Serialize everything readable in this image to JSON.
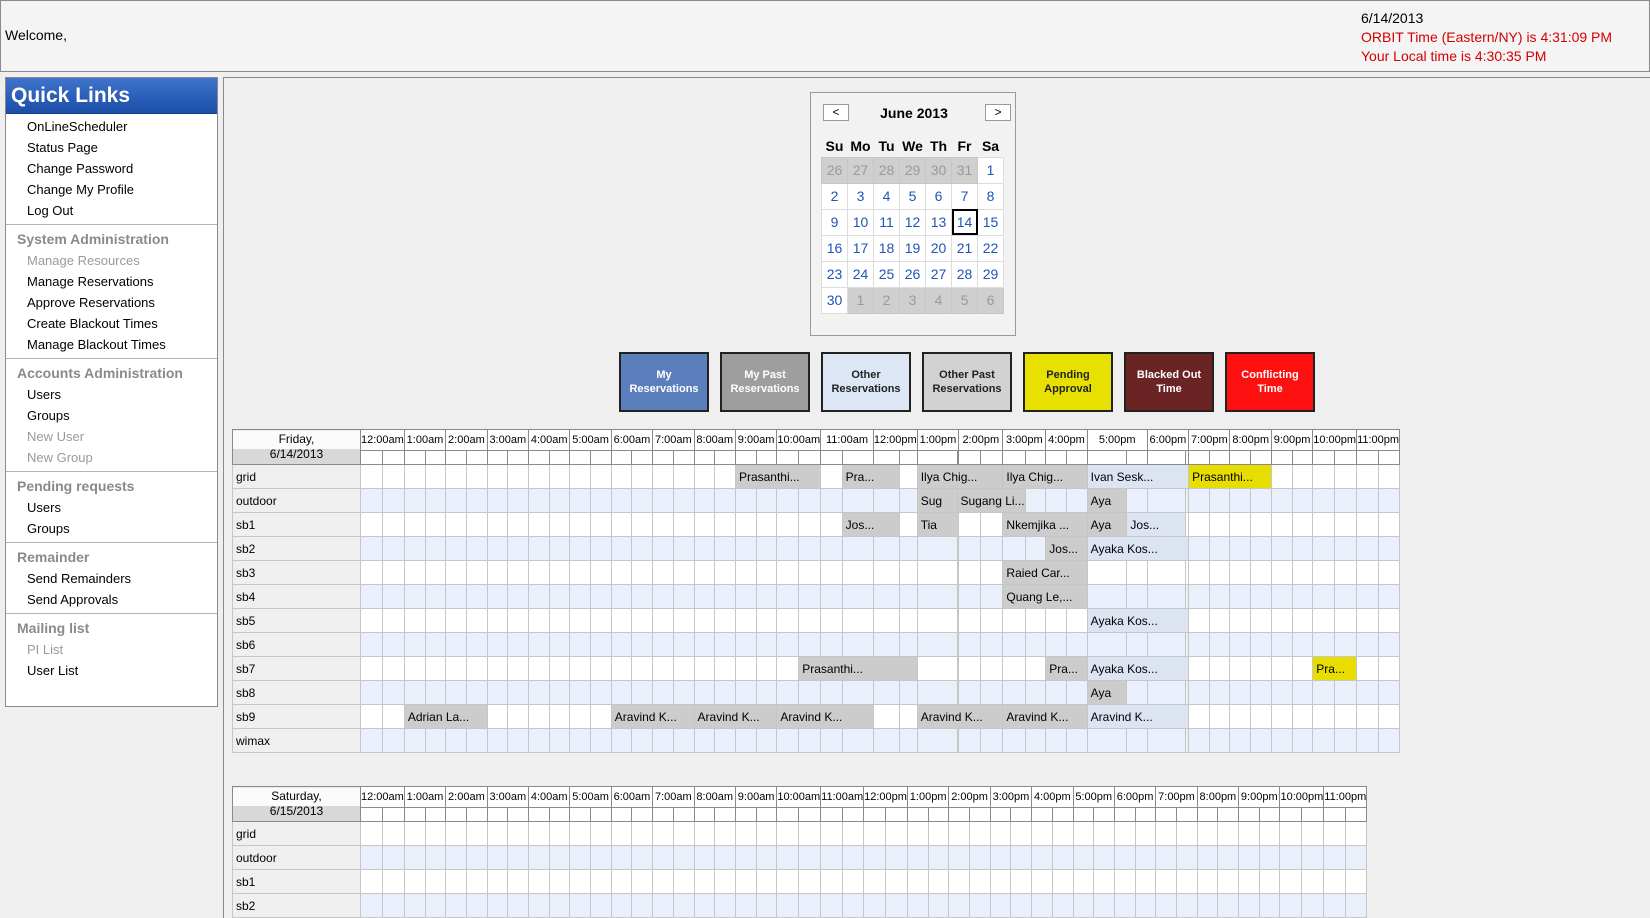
{
  "header": {
    "welcome": "Welcome,",
    "date": "6/14/2013",
    "orbit_time": "ORBIT Time (Eastern/NY) is 4:31:09 PM",
    "local_time": "Your Local time is 4:30:35 PM"
  },
  "quicklinks": {
    "title": "Quick Links",
    "groups": [
      {
        "heading": "",
        "links": [
          {
            "label": "OnLineScheduler",
            "enabled": true
          },
          {
            "label": "Status Page",
            "enabled": true
          },
          {
            "label": "Change Password",
            "enabled": true
          },
          {
            "label": "Change My Profile",
            "enabled": true
          },
          {
            "label": "Log Out",
            "enabled": true
          }
        ]
      },
      {
        "heading": "System Administration",
        "links": [
          {
            "label": "Manage Resources",
            "enabled": false
          },
          {
            "label": "Manage Reservations",
            "enabled": true
          },
          {
            "label": "Approve Reservations",
            "enabled": true
          },
          {
            "label": "Create Blackout Times",
            "enabled": true
          },
          {
            "label": "Manage Blackout Times",
            "enabled": true
          }
        ]
      },
      {
        "heading": "Accounts Administration",
        "links": [
          {
            "label": "Users",
            "enabled": true
          },
          {
            "label": "Groups",
            "enabled": true
          },
          {
            "label": "New User",
            "enabled": false
          },
          {
            "label": "New Group",
            "enabled": false
          }
        ]
      },
      {
        "heading": "Pending requests",
        "links": [
          {
            "label": "Users",
            "enabled": true
          },
          {
            "label": "Groups",
            "enabled": true
          }
        ]
      },
      {
        "heading": "Remainder",
        "links": [
          {
            "label": "Send Remainders",
            "enabled": true
          },
          {
            "label": "Send Approvals",
            "enabled": true
          }
        ]
      },
      {
        "heading": "Mailing list",
        "links": [
          {
            "label": "PI List",
            "enabled": false
          },
          {
            "label": "User List",
            "enabled": true
          }
        ]
      }
    ]
  },
  "calendar": {
    "title": "June 2013",
    "prev": "<",
    "next": ">",
    "weekdays": [
      "Su",
      "Mo",
      "Tu",
      "We",
      "Th",
      "Fr",
      "Sa"
    ],
    "weeks": [
      [
        {
          "d": "26",
          "o": true
        },
        {
          "d": "27",
          "o": true
        },
        {
          "d": "28",
          "o": true
        },
        {
          "d": "29",
          "o": true
        },
        {
          "d": "30",
          "o": true
        },
        {
          "d": "31",
          "o": true
        },
        {
          "d": "1"
        }
      ],
      [
        {
          "d": "2"
        },
        {
          "d": "3"
        },
        {
          "d": "4"
        },
        {
          "d": "5"
        },
        {
          "d": "6"
        },
        {
          "d": "7"
        },
        {
          "d": "8"
        }
      ],
      [
        {
          "d": "9"
        },
        {
          "d": "10"
        },
        {
          "d": "11"
        },
        {
          "d": "12"
        },
        {
          "d": "13"
        },
        {
          "d": "14",
          "t": true
        },
        {
          "d": "15"
        }
      ],
      [
        {
          "d": "16"
        },
        {
          "d": "17"
        },
        {
          "d": "18"
        },
        {
          "d": "19"
        },
        {
          "d": "20"
        },
        {
          "d": "21"
        },
        {
          "d": "22"
        }
      ],
      [
        {
          "d": "23"
        },
        {
          "d": "24"
        },
        {
          "d": "25"
        },
        {
          "d": "26"
        },
        {
          "d": "27"
        },
        {
          "d": "28"
        },
        {
          "d": "29"
        }
      ],
      [
        {
          "d": "30"
        },
        {
          "d": "1",
          "o": true
        },
        {
          "d": "2",
          "o": true
        },
        {
          "d": "3",
          "o": true
        },
        {
          "d": "4",
          "o": true
        },
        {
          "d": "5",
          "o": true
        },
        {
          "d": "6",
          "o": true
        }
      ]
    ]
  },
  "legend": [
    {
      "label": "My Reservations",
      "bg": "#5b7fbd",
      "fg": "#ffffff"
    },
    {
      "label": "My Past Reservations",
      "bg": "#9e9e9e",
      "fg": "#ffffff"
    },
    {
      "label": "Other Reservations",
      "bg": "#dce6f5",
      "fg": "#222222"
    },
    {
      "label": "Other Past Reservations",
      "bg": "#d2d2d2",
      "fg": "#222222"
    },
    {
      "label": "Pending Approval",
      "bg": "#e8e000",
      "fg": "#222222"
    },
    {
      "label": "Blacked Out Time",
      "bg": "#6b2424",
      "fg": "#ffffff"
    },
    {
      "label": "Conflicting Time",
      "bg": "#ff1010",
      "fg": "#ffffff"
    }
  ],
  "hours": [
    "12:00am",
    "1:00am",
    "2:00am",
    "3:00am",
    "4:00am",
    "5:00am",
    "6:00am",
    "7:00am",
    "8:00am",
    "9:00am",
    "10:00am",
    "11:00am",
    "12:00pm",
    "1:00pm",
    "2:00pm",
    "3:00pm",
    "4:00pm",
    "5:00pm",
    "6:00pm",
    "7:00pm",
    "8:00pm",
    "9:00pm",
    "10:00pm",
    "11:00pm"
  ],
  "days": [
    {
      "day": "Friday,",
      "date": "6/14/2013",
      "resources": [
        {
          "name": "grid",
          "blocks": [
            {
              "start": 18,
              "span": 4,
              "label": "Prasanthi...",
              "kind": "other"
            },
            {
              "start": 23,
              "span": 2,
              "label": "Pra...",
              "kind": "other"
            },
            {
              "start": 26,
              "span": 4,
              "label": "Ilya Chig...",
              "kind": "other"
            },
            {
              "start": 30,
              "span": 4,
              "label": "Ilya Chig...",
              "kind": "other"
            },
            {
              "start": 34,
              "span": 4,
              "label": "Ivan Sesk...",
              "kind": "mine"
            },
            {
              "start": 38,
              "span": 4,
              "label": "Prasanthi...",
              "kind": "pending"
            }
          ]
        },
        {
          "name": "outdoor",
          "blocks": [
            {
              "start": 26,
              "span": 1,
              "label": "Sug",
              "kind": "other"
            },
            {
              "start": 27,
              "span": 4,
              "label": "Sugang Li...",
              "kind": "other"
            },
            {
              "start": 34,
              "span": 1,
              "label": "Aya",
              "kind": "other"
            }
          ]
        },
        {
          "name": "sb1",
          "blocks": [
            {
              "start": 23,
              "span": 2,
              "label": "Jos...",
              "kind": "other"
            },
            {
              "start": 26,
              "span": 2,
              "label": "Tia",
              "kind": "other"
            },
            {
              "start": 30,
              "span": 4,
              "label": "Nkemjika ...",
              "kind": "other"
            },
            {
              "start": 34,
              "span": 1,
              "label": "Aya",
              "kind": "other"
            },
            {
              "start": 35,
              "span": 2,
              "label": "Jos...",
              "kind": "mine"
            }
          ]
        },
        {
          "name": "sb2",
          "blocks": [
            {
              "start": 32,
              "span": 2,
              "label": "Jos...",
              "kind": "other"
            },
            {
              "start": 34,
              "span": 4,
              "label": "Ayaka Kos...",
              "kind": "mine"
            }
          ]
        },
        {
          "name": "sb3",
          "blocks": [
            {
              "start": 30,
              "span": 4,
              "label": "Raied Car...",
              "kind": "other"
            }
          ]
        },
        {
          "name": "sb4",
          "blocks": [
            {
              "start": 30,
              "span": 4,
              "label": "Quang Le,...",
              "kind": "other"
            }
          ]
        },
        {
          "name": "sb5",
          "blocks": [
            {
              "start": 34,
              "span": 4,
              "label": "Ayaka Kos...",
              "kind": "mine"
            }
          ]
        },
        {
          "name": "sb6",
          "blocks": []
        },
        {
          "name": "sb7",
          "blocks": [
            {
              "start": 21,
              "span": 5,
              "label": "Prasanthi...",
              "kind": "other"
            },
            {
              "start": 32,
              "span": 2,
              "label": "Pra...",
              "kind": "other"
            },
            {
              "start": 34,
              "span": 4,
              "label": "Ayaka Kos...",
              "kind": "mine"
            },
            {
              "start": 44,
              "span": 2,
              "label": "Pra...",
              "kind": "pending"
            }
          ]
        },
        {
          "name": "sb8",
          "blocks": [
            {
              "start": 34,
              "span": 1,
              "label": "Aya",
              "kind": "other"
            }
          ]
        },
        {
          "name": "sb9",
          "blocks": [
            {
              "start": 2,
              "span": 4,
              "label": "Adrian La...",
              "kind": "other"
            },
            {
              "start": 12,
              "span": 4,
              "label": "Aravind K...",
              "kind": "other"
            },
            {
              "start": 16,
              "span": 4,
              "label": "Aravind K...",
              "kind": "other"
            },
            {
              "start": 20,
              "span": 4,
              "label": "Aravind K...",
              "kind": "other"
            },
            {
              "start": 26,
              "span": 4,
              "label": "Aravind K...",
              "kind": "other"
            },
            {
              "start": 30,
              "span": 4,
              "label": "Aravind K...",
              "kind": "other"
            },
            {
              "start": 34,
              "span": 4,
              "label": "Aravind K...",
              "kind": "mine"
            }
          ]
        },
        {
          "name": "wimax",
          "blocks": []
        }
      ]
    },
    {
      "day": "Saturday,",
      "date": "6/15/2013",
      "resources": [
        {
          "name": "grid",
          "blocks": []
        },
        {
          "name": "outdoor",
          "blocks": []
        },
        {
          "name": "sb1",
          "blocks": []
        },
        {
          "name": "sb2",
          "blocks": []
        }
      ]
    }
  ]
}
